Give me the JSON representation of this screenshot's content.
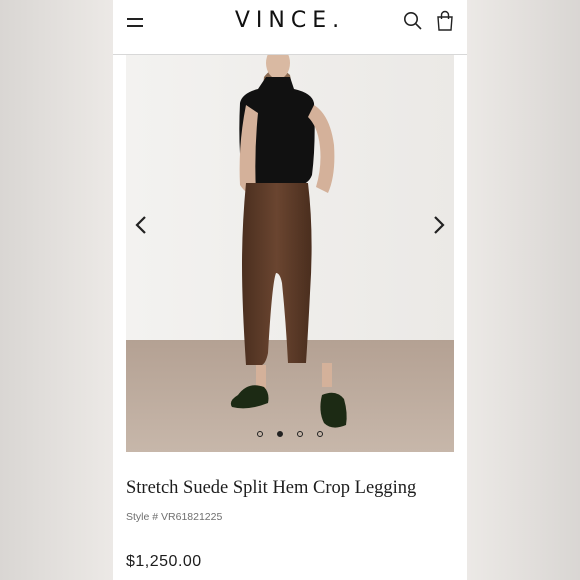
{
  "brand": {
    "logo_text": "VINCE."
  },
  "header": {
    "menu_icon": "hamburger-menu-icon",
    "search_icon": "search-icon",
    "bag_icon": "shopping-bag-icon"
  },
  "carousel": {
    "image_alt": "Model wearing black sleeveless turtleneck and brown suede cropped leggings with loafers",
    "prev_icon": "chevron-left-icon",
    "next_icon": "chevron-right-icon",
    "slide_count": 4,
    "active_slide": 2
  },
  "product": {
    "title": "Stretch Suede Split Hem Crop Legging",
    "style_number": "Style # VR61821225",
    "price": "$1,250.00"
  },
  "colors": {
    "accent": "#222222",
    "legging_brown": "#5b3a26",
    "top_black": "#111111"
  }
}
